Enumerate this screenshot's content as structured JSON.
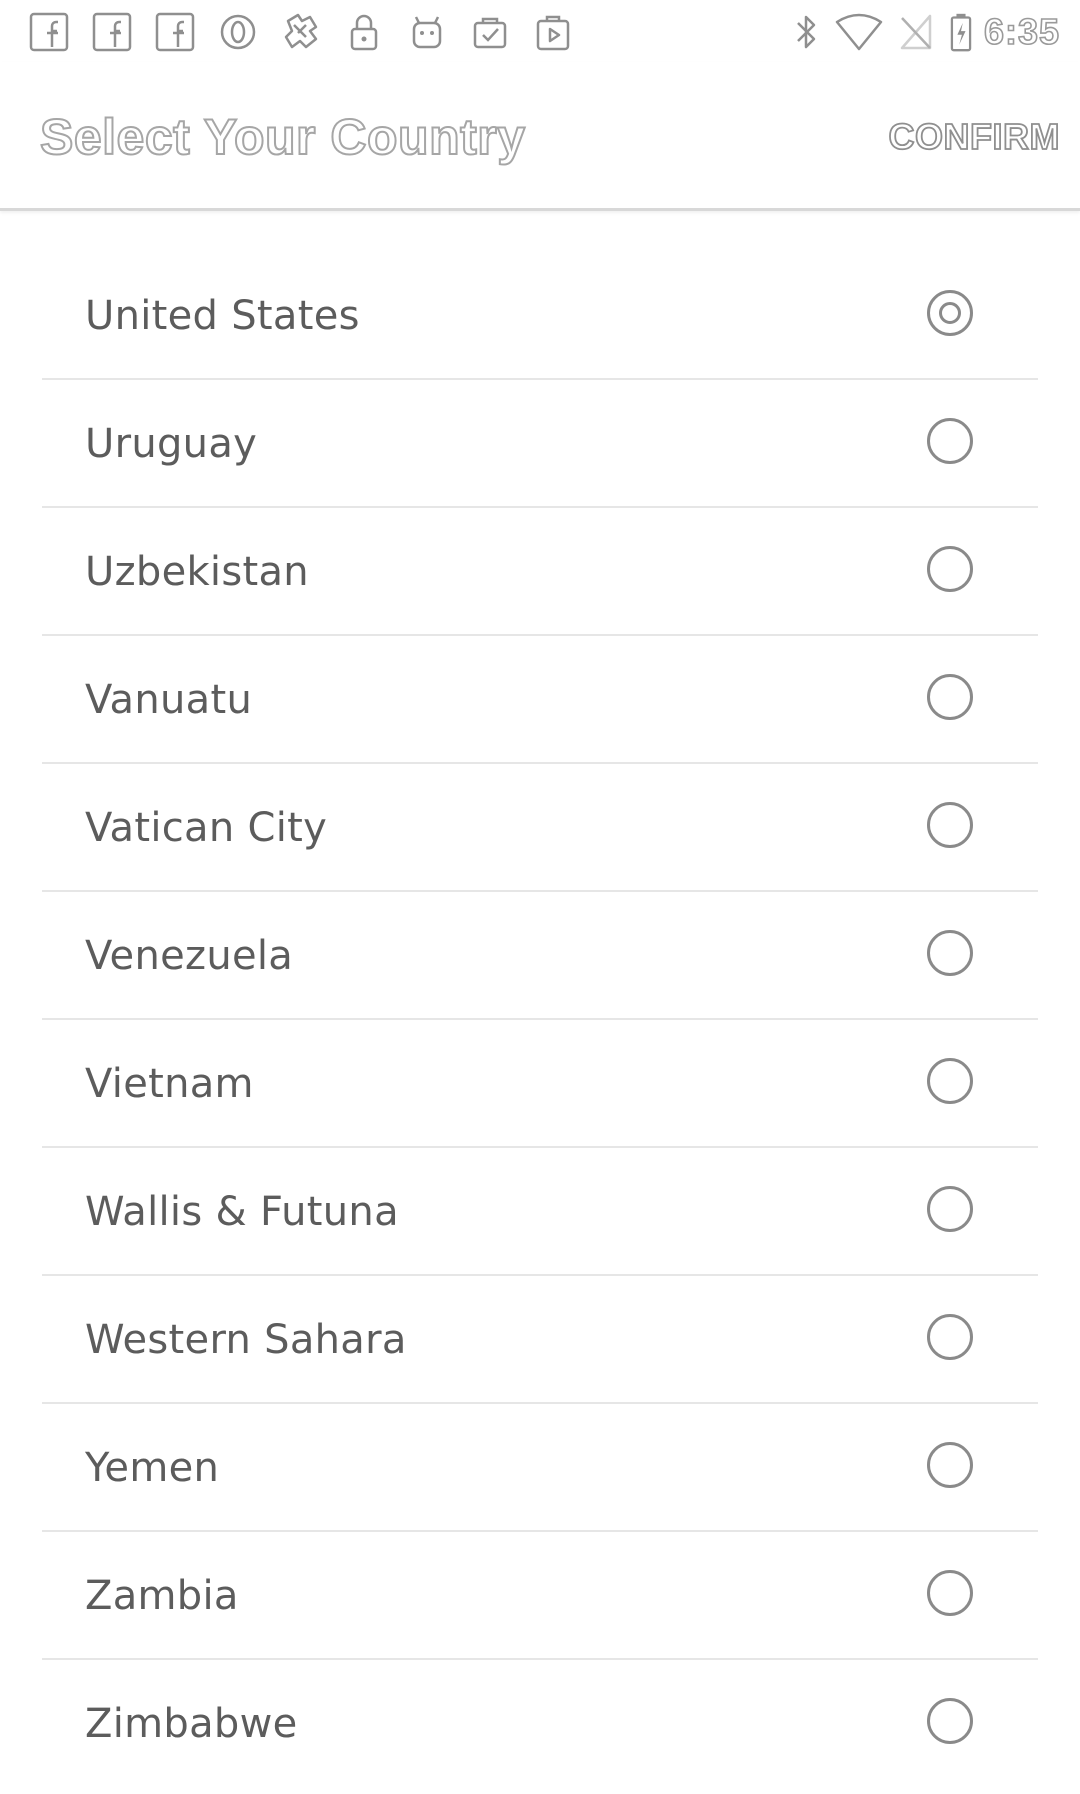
{
  "status_bar": {
    "left_icons": [
      "facebook-icon",
      "facebook-icon",
      "facebook-icon",
      "opera-icon",
      "puzzle-icon",
      "lock-icon",
      "android-icon",
      "clipboard-check-icon",
      "play-store-icon"
    ],
    "right_icons": [
      "bluetooth-icon",
      "wifi-icon",
      "no-signal-icon",
      "battery-charging-icon"
    ],
    "time": "6:35"
  },
  "app_bar": {
    "title": "Select Your Country",
    "confirm_label": "CONFIRM"
  },
  "countries": [
    {
      "name": "United States",
      "selected": true
    },
    {
      "name": "Uruguay",
      "selected": false
    },
    {
      "name": "Uzbekistan",
      "selected": false
    },
    {
      "name": "Vanuatu",
      "selected": false
    },
    {
      "name": "Vatican City",
      "selected": false
    },
    {
      "name": "Venezuela",
      "selected": false
    },
    {
      "name": "Vietnam",
      "selected": false
    },
    {
      "name": "Wallis & Futuna",
      "selected": false
    },
    {
      "name": "Western Sahara",
      "selected": false
    },
    {
      "name": "Yemen",
      "selected": false
    },
    {
      "name": "Zambia",
      "selected": false
    },
    {
      "name": "Zimbabwe",
      "selected": false
    }
  ]
}
